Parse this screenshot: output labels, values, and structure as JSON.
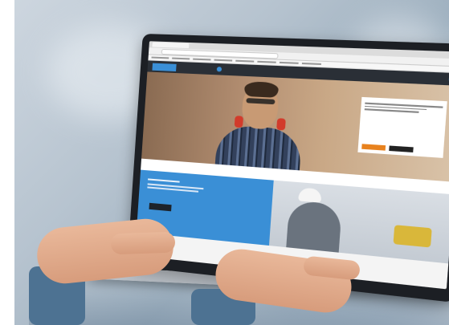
{
  "scene": {
    "description_colors": {
      "laptop_frame": "#1c1f24",
      "accent_blue": "#3a8fd6",
      "cta_orange": "#e8821e"
    }
  },
  "screen_site": {
    "nav_items": [
      "",
      "",
      "",
      "",
      ""
    ],
    "hero_promo_title": "",
    "band_text": "",
    "icons": [
      "logo-icon"
    ]
  }
}
